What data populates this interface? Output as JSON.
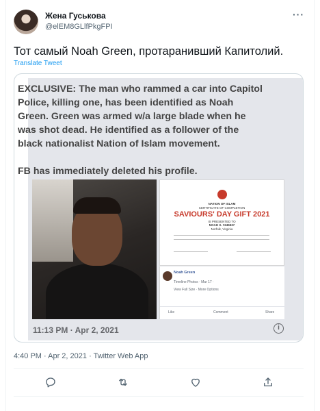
{
  "author": {
    "name": "Жена Гуськова",
    "handle": "@elEM8GLlfPkgFPI"
  },
  "more_label": "···",
  "tweet": {
    "text": "Тот самый Noah Green, протаранивший Капитолий.",
    "translate_label": "Translate Tweet"
  },
  "embedded": {
    "text": "EXCLUSIVE: The man who rammed a car into Capitol\nPolice, killing one, has been identified as Noah\nGreen. Green was armed w/a large blade when he\nwas shot dead. He identified as a follower of the\nblack nationalist Nation of Islam movement.\n\nFB has immediately deleted his profile.",
    "timestamp": "11:13 PM · Apr 2, 2021",
    "info_icon": "i",
    "certificate": {
      "org": "NATION OF ISLAM",
      "subtitle": "CERTIFICATE OF COMPLETION",
      "title": "SAVIOURS' DAY GIFT 2021",
      "presented": "IS PRESENTED TO",
      "recipient": "NOAH X. #245537",
      "location": "Norfolk, Virginia"
    },
    "fb": {
      "name": "Noah Green",
      "meta": "Timeline Photos · Mar 17 · ",
      "view": "View Full Size · More Options",
      "like": "Like",
      "comment": "Comment",
      "share": "Share"
    }
  },
  "meta": "4:40 PM · Apr 2, 2021 · Twitter Web App",
  "icons": [
    "reply-icon",
    "retweet-icon",
    "like-icon",
    "share-icon"
  ],
  "colors": {
    "link": "#1d9bf0",
    "text": "#0f1419",
    "muted": "#536471",
    "cert_red": "#c73a2b"
  }
}
